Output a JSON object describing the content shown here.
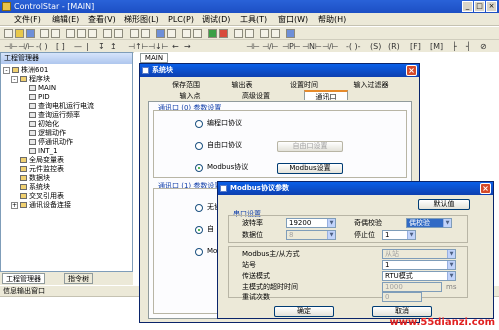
{
  "app": {
    "title": "ControlStar - [MAIN]"
  },
  "menu": [
    "文件(F)",
    "编辑(E)",
    "查看(V)",
    "梯形图(L)",
    "PLC(P)",
    "调试(D)",
    "工具(T)",
    "窗口(W)",
    "帮助(H)"
  ],
  "left_panel": {
    "title": "工程管理器",
    "tree": [
      {
        "label": "株洲601",
        "level": 0,
        "pm": "-"
      },
      {
        "label": "程序块",
        "level": 1,
        "pm": "-"
      },
      {
        "label": "MAIN",
        "level": 2
      },
      {
        "label": "PID",
        "level": 2
      },
      {
        "label": "查询电机运行电流",
        "level": 2
      },
      {
        "label": "查询运行频率",
        "level": 2
      },
      {
        "label": "初始化",
        "level": 2
      },
      {
        "label": "逻辑动作",
        "level": 2
      },
      {
        "label": "停通讯动作",
        "level": 2
      },
      {
        "label": "INT_1",
        "level": 2
      },
      {
        "label": "全局变量表",
        "level": 1
      },
      {
        "label": "元件监控表",
        "level": 1
      },
      {
        "label": "数据块",
        "level": 1
      },
      {
        "label": "系统块",
        "level": 1
      },
      {
        "label": "交叉引用表",
        "level": 1
      },
      {
        "label": "通讯设备连接",
        "level": 1,
        "pm": "+"
      }
    ],
    "tabs": [
      "工程管理器",
      "指令树"
    ]
  },
  "info_window": {
    "title": "信息输出窗口"
  },
  "editor": {
    "tab": "MAIN"
  },
  "system_dialog": {
    "title": "系统块",
    "tabs_row1": [
      "保存范围",
      "输出表",
      "设置时间",
      "输入过滤器"
    ],
    "tabs_row2": [
      "输入点",
      "高级设置",
      "通讯口"
    ],
    "group0_label": "通讯口 (0) 参数设置",
    "group0_options": [
      "编程口协议",
      "自由口协议",
      "Modbus协议"
    ],
    "free_port_btn": "自由口设置",
    "modbus_btn": "Modbus设置",
    "group1_label": "通讯口 (1) 参数设置",
    "group1_options": [
      "无协",
      "自",
      "Mod"
    ]
  },
  "modbus_dialog": {
    "title": "Modbus协议参数",
    "default_btn": "默认值",
    "serial_group": "串口设置",
    "baud_label": "波特率",
    "baud_value": "19200",
    "parity_label": "奇偶校验",
    "parity_value": "偶校验",
    "databits_label": "数据位",
    "databits_value": "8",
    "stopbits_label": "停止位",
    "stopbits_value": "1",
    "role_label": "Modbus主/从方式",
    "role_value": "从站",
    "station_label": "站号",
    "station_value": "1",
    "mode_label": "传送模式",
    "mode_value": "RTU模式",
    "timeout_label": "主模式的超时时间",
    "timeout_value": "1000",
    "timeout_unit": "ms",
    "retry_label": "重试次数",
    "retry_value": "0",
    "ok_btn": "确定",
    "cancel_btn": "取消"
  },
  "watermark": "www.55dianzi.com"
}
